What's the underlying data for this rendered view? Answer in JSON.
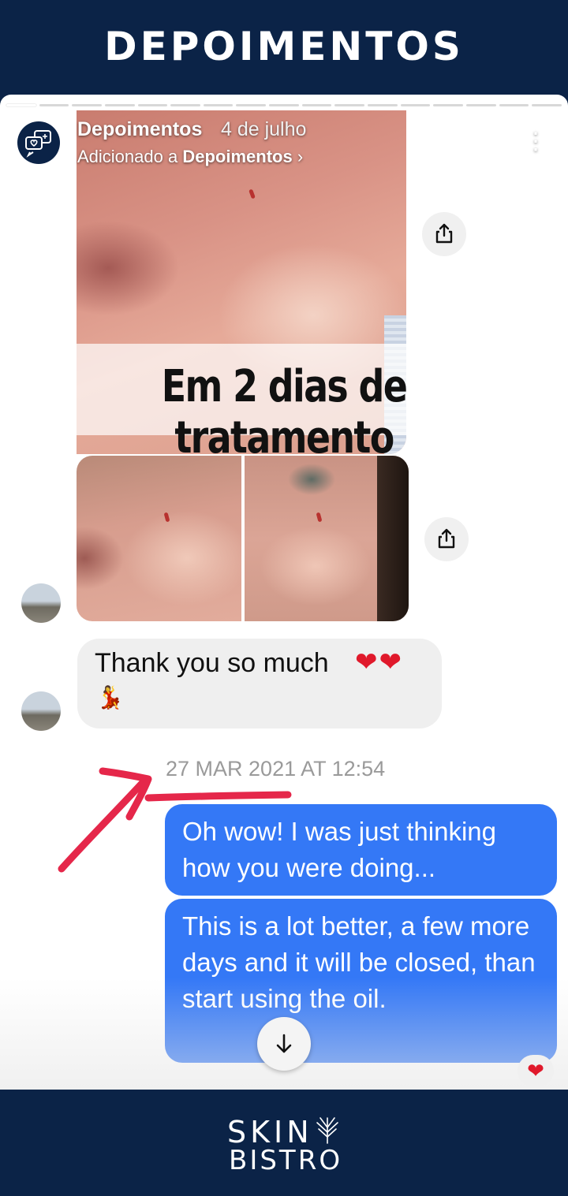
{
  "banner": {
    "title": "DEPOIMENTOS"
  },
  "story": {
    "user": "Depoimentos",
    "date": "4 de julho",
    "added_prefix": "Adicionado a",
    "added_target": "Depoimentos",
    "added_chevron": "›",
    "more_icon": "⋮",
    "progress_segments": 17,
    "progress_done": 1
  },
  "photo": {
    "overlay_text": "Em 2 dias de tratamento"
  },
  "chat": {
    "incoming_text": "Thank you so much",
    "incoming_hearts": "❤❤",
    "incoming_emoji": "💃",
    "timestamp": "27 MAR 2021 AT 12:54",
    "outgoing": [
      "Oh wow! I was just thinking how you were doing...",
      "This is a lot better, a few more days and it will be closed, than start using the oil."
    ],
    "reaction": "❤"
  },
  "brand": {
    "line1": "SKIN",
    "line2": "BISTRO"
  },
  "colors": {
    "navy": "#0b2347",
    "outgoing_bubble": "#3478f6",
    "incoming_bubble": "#efefef",
    "annotation_arrow": "#e5274a",
    "heart": "#e0192b"
  },
  "icons": [
    "chat-hearts-logo-icon",
    "more-vertical-icon",
    "share-icon",
    "arrow-down-icon",
    "heart-icon",
    "brand-mark-icon"
  ]
}
